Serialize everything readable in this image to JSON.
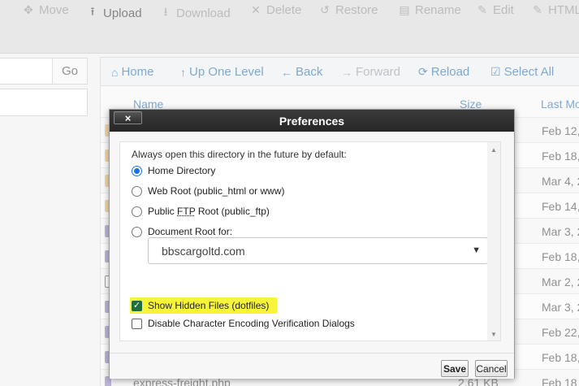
{
  "toolbar": {
    "items": [
      {
        "label": "Move",
        "icon": "move-icon",
        "glyph": "✥",
        "state": "disabled"
      },
      {
        "label": "Upload",
        "icon": "upload-icon",
        "glyph": "⭱",
        "state": "active"
      },
      {
        "label": "Download",
        "icon": "download-icon",
        "glyph": "⭳",
        "state": "disabled"
      },
      {
        "label": "Delete",
        "icon": "delete-icon",
        "glyph": "✕",
        "state": "disabled"
      },
      {
        "label": "Restore",
        "icon": "restore-icon",
        "glyph": "↺",
        "state": "disabled"
      },
      {
        "label": "Rename",
        "icon": "rename-icon",
        "glyph": "▤",
        "state": "disabled"
      },
      {
        "label": "Edit",
        "icon": "edit-icon",
        "glyph": "✎",
        "state": "disabled"
      },
      {
        "label": "HTML",
        "icon": "html-editor-icon",
        "glyph": "✎",
        "state": "disabled"
      }
    ]
  },
  "path": {
    "go_label": "Go"
  },
  "nav": {
    "items": [
      {
        "label": "Home",
        "icon": "home-icon",
        "glyph": "⌂",
        "state": "active"
      },
      {
        "label": "Up One Level",
        "icon": "up-level-icon",
        "glyph": "↑",
        "state": "active"
      },
      {
        "label": "Back",
        "icon": "back-icon",
        "glyph": "←",
        "state": "active"
      },
      {
        "label": "Forward",
        "icon": "forward-icon",
        "glyph": "→",
        "state": "disabled"
      },
      {
        "label": "Reload",
        "icon": "reload-icon",
        "glyph": "⟳",
        "state": "active"
      },
      {
        "label": "Select All",
        "icon": "select-all-icon",
        "glyph": "☑",
        "state": "active"
      }
    ]
  },
  "table": {
    "headers": {
      "name": "Name",
      "size": "Size",
      "modified": "Last Mo"
    },
    "rows": [
      {
        "date": "Feb 12,",
        "color": "#e8c07a"
      },
      {
        "date": "Feb 18,",
        "color": "#e8c07a"
      },
      {
        "date": "Mar 4, 2",
        "color": "#e8c07a"
      },
      {
        "date": "Feb 14,",
        "color": "#e8c07a"
      },
      {
        "date": "Mar 3, 2",
        "color": "#9b8cc4"
      },
      {
        "date": "Feb 18,",
        "color": "#9b8cc4"
      },
      {
        "date": "Mar 2, 2",
        "color": "#ffffff"
      },
      {
        "date": "Mar 3, 2",
        "color": "#9b8cc4"
      },
      {
        "date": "Feb 22,",
        "color": "#9b8cc4"
      },
      {
        "date": "Feb 18,",
        "color": "#9b8cc4"
      },
      {
        "date": "Feb 18",
        "color": "#9b8cc4",
        "name": "express-freight.php",
        "size": "2.61 KB"
      }
    ]
  },
  "dialog": {
    "title": "Preferences",
    "close_label": "×",
    "intro": "Always open this directory in the future by default:",
    "options": {
      "home": "Home Directory",
      "webroot": "Web Root (public_html or www)",
      "ftp_prefix": "Public ",
      "ftp_abbr": "FTP",
      "ftp_suffix": " Root (public_ftp)",
      "docroot": "Document Root for:"
    },
    "domain_select": "bbscargoltd.com",
    "show_hidden": "Show Hidden Files (dotfiles)",
    "disable_encoding": "Disable Character Encoding Verification Dialogs",
    "save_label": "Save",
    "cancel_label": "Cancel"
  },
  "colors": {
    "accent": "#3a7cb8",
    "highlight": "#f7f53a",
    "dialog_title_bg": "#2e2e2e"
  }
}
